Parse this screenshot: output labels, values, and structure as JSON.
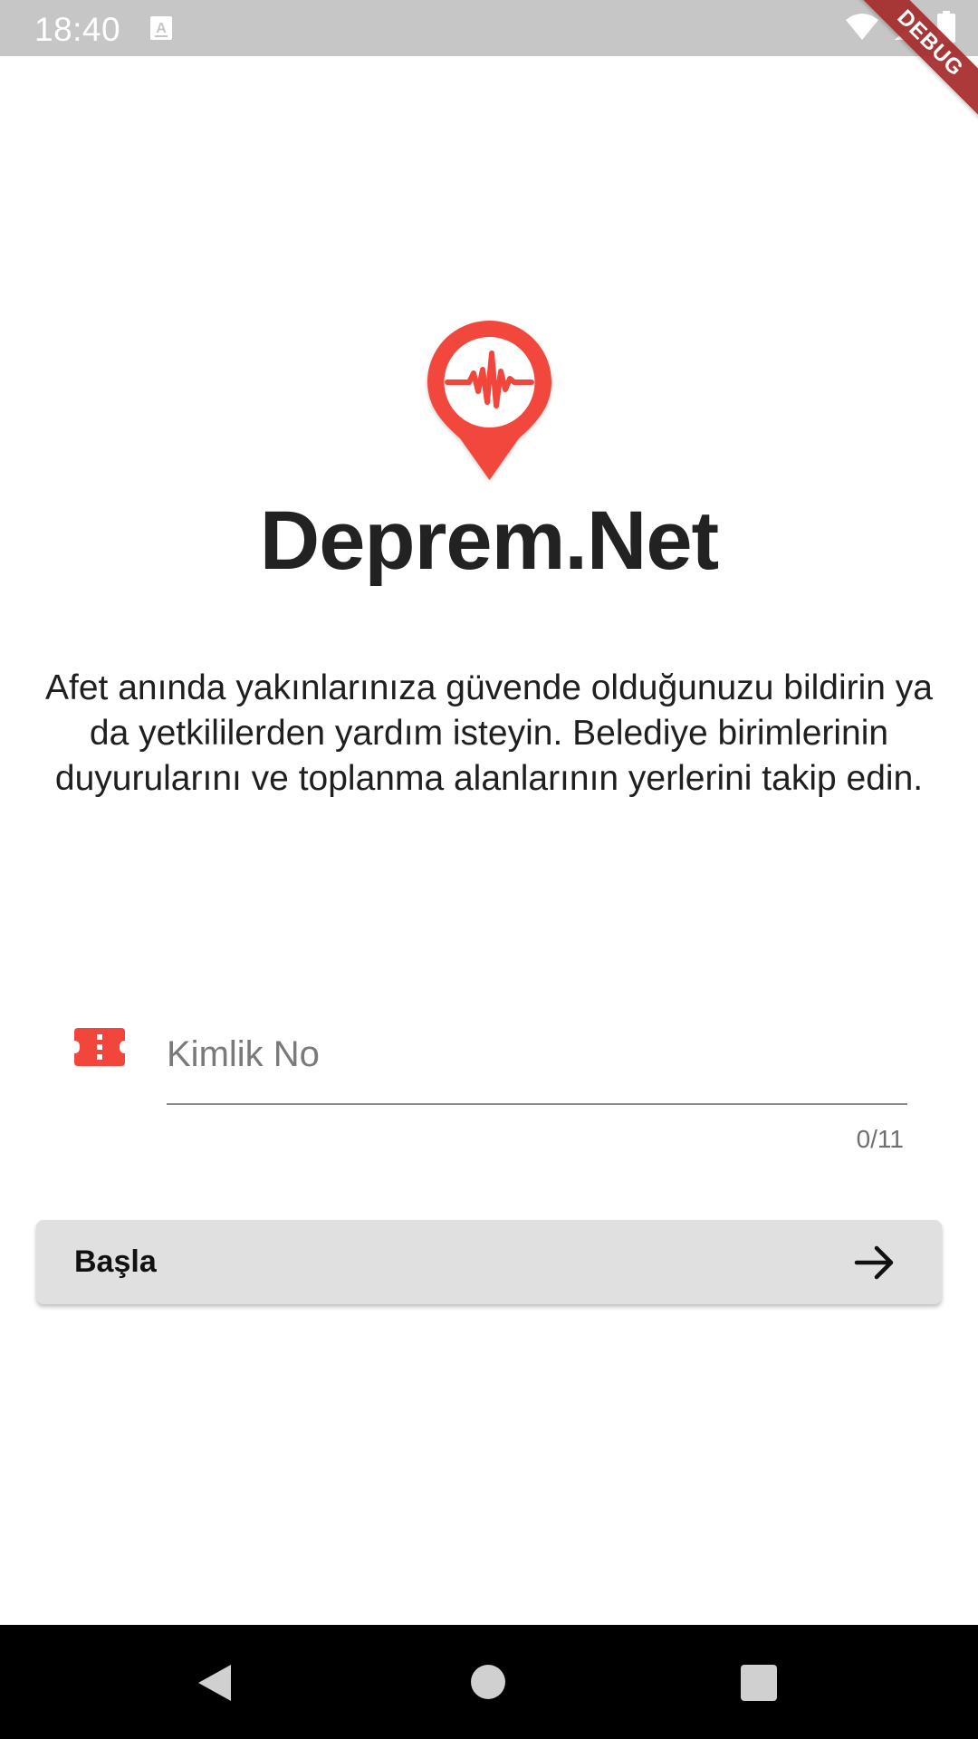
{
  "status_bar": {
    "time": "18:40",
    "icons": [
      "a-notification-icon",
      "wifi-icon",
      "signal-icon",
      "battery-icon"
    ]
  },
  "debug_banner": "DEBUG",
  "app": {
    "title": "Deprem.Net",
    "description": "Afet anında yakınlarınıza güvende olduğunuzu bildirin ya da yetkililerden yardım isteyin. Belediye birimlerinin duyurularını ve toplanma alanlarının yerlerini takip edin.",
    "brand_color": "#f2463c"
  },
  "form": {
    "id_placeholder": "Kimlik No",
    "id_value": "",
    "counter": "0/11",
    "start_label": "Başla"
  },
  "nav": {
    "buttons": [
      "back-icon",
      "home-icon",
      "recents-icon"
    ]
  }
}
